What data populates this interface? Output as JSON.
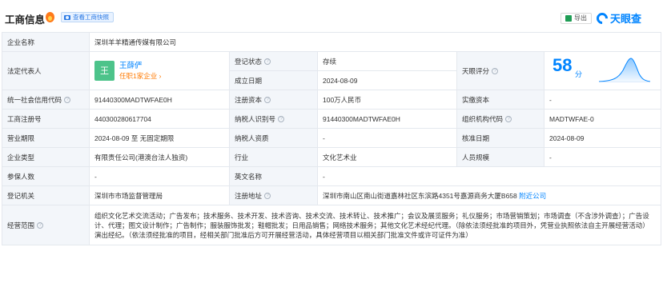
{
  "header": {
    "title": "工商信息",
    "snapshot_label": "查看工商快照",
    "export_label": "导出",
    "brand_name": "天眼查"
  },
  "rows": {
    "company_name": {
      "label": "企业名称",
      "value": "深圳羊羊精通传媒有限公司"
    },
    "legal_rep": {
      "label": "法定代表人",
      "avatar_char": "王",
      "name": "王薛俨",
      "sub": "任职1家企业 ›"
    },
    "reg_status": {
      "label": "登记状态",
      "value": "存续"
    },
    "found_date": {
      "label": "成立日期",
      "value": "2024-08-09"
    },
    "tianyan_score": {
      "label": "天眼评分",
      "score": "58",
      "unit": "分"
    },
    "credit_code": {
      "label": "统一社会信用代码",
      "value": "91440300MADTWFAE0H"
    },
    "reg_capital": {
      "label": "注册资本",
      "value": "100万人民币"
    },
    "paid_capital": {
      "label": "实缴资本",
      "value": "-"
    },
    "reg_number": {
      "label": "工商注册号",
      "value": "440300280617704"
    },
    "taxpayer_id": {
      "label": "纳税人识别号",
      "value": "91440300MADTWFAE0H"
    },
    "org_code": {
      "label": "组织机构代码",
      "value": "MADTWFAE-0"
    },
    "biz_term": {
      "label": "营业期限",
      "value": "2024-08-09 至 无固定期限"
    },
    "taxpayer_qual": {
      "label": "纳税人资质",
      "value": "-"
    },
    "approval_date": {
      "label": "核准日期",
      "value": "2024-08-09"
    },
    "company_type": {
      "label": "企业类型",
      "value": "有限责任公司(港澳台法人独资)"
    },
    "industry": {
      "label": "行业",
      "value": "文化艺术业"
    },
    "staff_size": {
      "label": "人员规模",
      "value": "-"
    },
    "insured": {
      "label": "参保人数",
      "value": "-"
    },
    "english_name": {
      "label": "英文名称",
      "value": "-"
    },
    "reg_authority": {
      "label": "登记机关",
      "value": "深圳市市场监督管理局"
    },
    "reg_address": {
      "label": "注册地址",
      "value": "深圳市南山区南山街道嘉林社区东滨路4351号嘉源商务大厦B658",
      "link": "附近公司"
    },
    "biz_scope": {
      "label": "经营范围",
      "value": "组织文化艺术交流活动；广告发布；技术服务、技术开发、技术咨询、技术交流、技术转让、技术推广；会议及展览服务；礼仪服务；市场营销策划；市场调查（不含涉外调查）；广告设计、代理；图文设计制作；广告制作；服装服饰批发；鞋帽批发；日用品销售；网络技术服务；其他文化艺术经纪代理。（除依法须经批准的项目外，凭营业执照依法自主开展经营活动）演出经纪。（依法须经批准的项目，经相关部门批准后方可开展经营活动，具体经营项目以相关部门批准文件或许可证件为准）"
    }
  },
  "colors": {
    "label_bg": "#f3f6fa",
    "border": "#e4e8ee",
    "brand_blue": "#0084ff",
    "status_green": "#1aa363",
    "avatar_green": "#4cc38a",
    "accent_orange": "#ff7a00"
  }
}
